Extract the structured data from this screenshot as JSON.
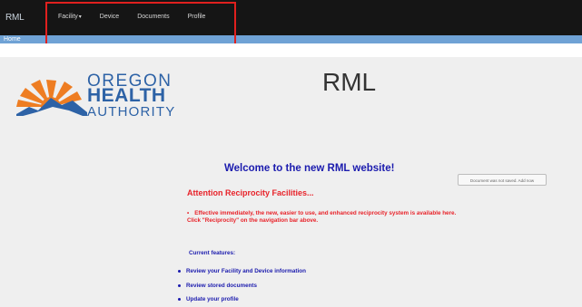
{
  "nav": {
    "brand": "RML",
    "items": [
      {
        "label": "Facility",
        "caret": "▾"
      },
      {
        "label": "Device"
      },
      {
        "label": "Documents"
      },
      {
        "label": "Profile"
      }
    ]
  },
  "breadcrumb": {
    "home": "Home"
  },
  "logo": {
    "line1": "OREGON",
    "line2": "HEALTH",
    "line3": "AUTHORITY"
  },
  "page_title": "RML",
  "welcome": "Welcome to the new RML website!",
  "document_button": "Document was not saved. Add now",
  "attention": "Attention Reciprocity Facilities...",
  "notice": {
    "line1": "Effective immediately, the new, easier to use, and enhanced reciprocity system is available here.",
    "line2": "Click \"Reciprocity\" on the navigation bar above."
  },
  "current_features_title": "Current features:",
  "features": [
    "Review your Facility and Device information",
    "Review stored documents",
    "Update your profile"
  ],
  "colors": {
    "navbar": "#151515",
    "breadcrumb_bar": "#6fa2d5",
    "highlight": "#e0201e",
    "logo_blue": "#2d62a6",
    "logo_orange": "#ee7d22",
    "welcome_blue": "#1b1bae",
    "alert_red": "#e8232a"
  }
}
